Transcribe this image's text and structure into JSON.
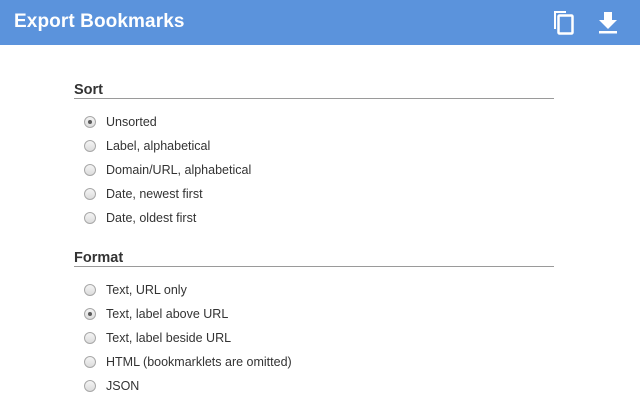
{
  "header": {
    "title": "Export Bookmarks",
    "background": "#5b93dc",
    "icons": [
      "copy-icon",
      "download-icon"
    ]
  },
  "sort": {
    "title": "Sort",
    "options": [
      {
        "label": "Unsorted",
        "checked": true
      },
      {
        "label": "Label, alphabetical",
        "checked": false
      },
      {
        "label": "Domain/URL, alphabetical",
        "checked": false
      },
      {
        "label": "Date, newest first",
        "checked": false
      },
      {
        "label": "Date, oldest first",
        "checked": false
      }
    ]
  },
  "format": {
    "title": "Format",
    "options": [
      {
        "label": "Text, URL only",
        "checked": false
      },
      {
        "label": "Text, label above URL",
        "checked": true
      },
      {
        "label": "Text, label beside URL",
        "checked": false
      },
      {
        "label": "HTML (bookmarklets are omitted)",
        "checked": false
      },
      {
        "label": "JSON",
        "checked": false
      }
    ]
  }
}
